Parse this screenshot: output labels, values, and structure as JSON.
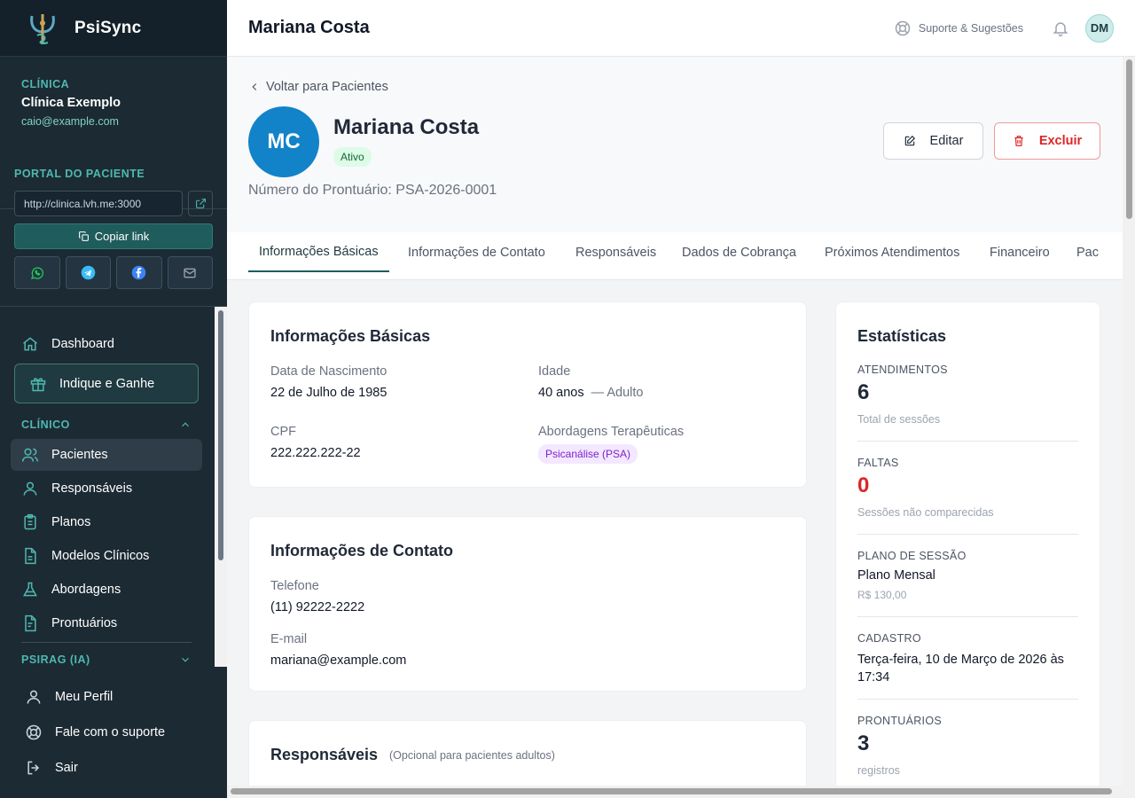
{
  "brand": {
    "name": "PsiSync"
  },
  "clinic": {
    "eyebrow": "CLÍNICA",
    "name": "Clínica Exemplo",
    "email": "caio@example.com"
  },
  "portal": {
    "eyebrow": "PORTAL DO PACIENTE",
    "url": "http://clinica.lvh.me:3000",
    "copy_label": "Copiar link"
  },
  "nav": {
    "dashboard": "Dashboard",
    "refer": "Indique e Ganhe",
    "clinical_section": "CLÍNICO",
    "items": [
      "Pacientes",
      "Responsáveis",
      "Planos",
      "Modelos Clínicos",
      "Abordagens",
      "Prontuários"
    ],
    "ai_section": "PSIRAG (IA)"
  },
  "bottom_nav": {
    "profile": "Meu Perfil",
    "support": "Fale com o suporte",
    "logout": "Sair"
  },
  "topbar": {
    "title": "Mariana Costa",
    "support_link": "Suporte & Sugestões",
    "user_initials": "DM"
  },
  "patient": {
    "back": "Voltar para Pacientes",
    "initials": "MC",
    "name": "Mariana Costa",
    "status": "Ativo",
    "record": "Número do Prontuário: PSA-2026-0001",
    "edit_label": "Editar",
    "delete_label": "Excluir"
  },
  "tabs": [
    "Informações Básicas",
    "Informações de Contato",
    "Responsáveis",
    "Dados de Cobrança",
    "Próximos Atendimentos",
    "Financeiro",
    "Pac"
  ],
  "basic": {
    "title": "Informações Básicas",
    "birth_label": "Data de Nascimento",
    "birth": "22 de Julho de 1985",
    "age_label": "Idade",
    "age": "40 anos",
    "age_group": "— Adulto",
    "cpf_label": "CPF",
    "cpf": "222.222.222-22",
    "approach_label": "Abordagens Terapêuticas",
    "approach": "Psicanálise (PSA)"
  },
  "contact": {
    "title": "Informações de Contato",
    "phone_label": "Telefone",
    "phone": "(11) 92222-2222",
    "email_label": "E-mail",
    "email": "mariana@example.com"
  },
  "guardians": {
    "title": "Responsáveis",
    "note": "(Opcional para pacientes adultos)"
  },
  "stats": {
    "title": "Estatísticas",
    "sessions_label": "ATENDIMENTOS",
    "sessions": "6",
    "sessions_sub": "Total de sessões",
    "absences_label": "FALTAS",
    "absences": "0",
    "absences_sub": "Sessões não comparecidas",
    "plan_label": "PLANO DE SESSÃO",
    "plan": "Plano Mensal",
    "plan_price": "R$ 130,00",
    "signup_label": "CADASTRO",
    "signup_line1": "Terça-feira, 10 de Março de 2026 às",
    "signup_line2": "17:34",
    "records_label": "PRONTUÁRIOS",
    "records": "3",
    "records_sub": "registros"
  },
  "colors": {
    "sidebar": "#1c2a33",
    "accent": "#1f5c5c",
    "teal_text": "#4fb8b0",
    "avatar": "#1283c9",
    "danger": "#dc2626"
  }
}
